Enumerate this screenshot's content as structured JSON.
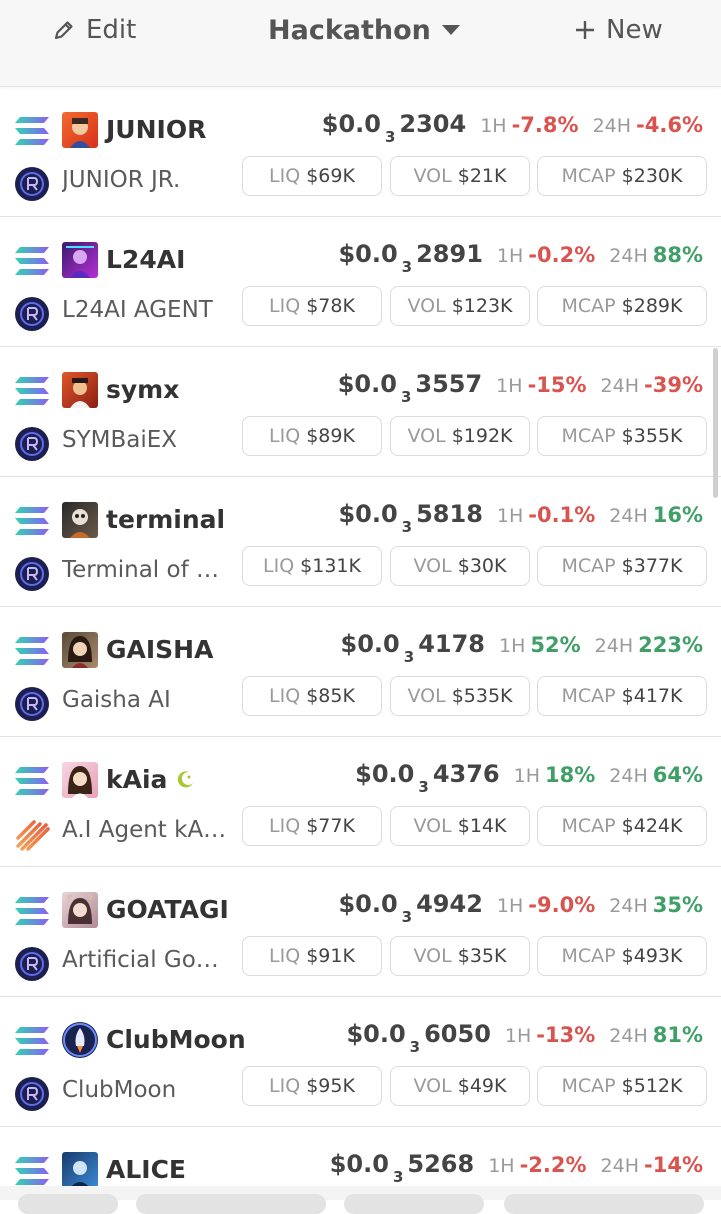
{
  "header": {
    "edit_label": "Edit",
    "title": "Hackathon",
    "new_label": "New"
  },
  "colors": {
    "negative": "#d9534f",
    "positive": "#3f9f67",
    "chain_gradient": [
      "#2fd6b0",
      "#8c5cf6"
    ]
  },
  "price_prefix": "$0.0",
  "labels": {
    "h1": "1H",
    "h24": "24H",
    "liq": "LIQ",
    "vol": "VOL",
    "mcap": "MCAP"
  },
  "tokens": [
    {
      "symbol": "JUNIOR",
      "name": "JUNIOR JR.",
      "zeros": "3",
      "price": "2304",
      "change_1h": "-7.8%",
      "change_24h": "-4.6%",
      "liq": "$69K",
      "vol": "$21K",
      "mcap": "$230K",
      "dex_icon": "raydium-icon"
    },
    {
      "symbol": "L24AI",
      "name": "L24AI AGENT",
      "zeros": "3",
      "price": "2891",
      "change_1h": "-0.2%",
      "change_24h": "88%",
      "liq": "$78K",
      "vol": "$123K",
      "mcap": "$289K",
      "dex_icon": "raydium-icon"
    },
    {
      "symbol": "symx",
      "name": "SYMBaiEX",
      "zeros": "3",
      "price": "3557",
      "change_1h": "-15%",
      "change_24h": "-39%",
      "liq": "$89K",
      "vol": "$192K",
      "mcap": "$355K",
      "dex_icon": "raydium-icon"
    },
    {
      "symbol": "terminal",
      "name": "Terminal of …",
      "zeros": "3",
      "price": "5818",
      "change_1h": "-0.1%",
      "change_24h": "16%",
      "liq": "$131K",
      "vol": "$30K",
      "mcap": "$377K",
      "dex_icon": "raydium-icon"
    },
    {
      "symbol": "GAISHA",
      "name": "Gaisha AI",
      "zeros": "3",
      "price": "4178",
      "change_1h": "52%",
      "change_24h": "223%",
      "liq": "$85K",
      "vol": "$535K",
      "mcap": "$417K",
      "dex_icon": "raydium-icon"
    },
    {
      "symbol": "kAia",
      "name": "A.I Agent kA…",
      "zeros": "3",
      "price": "4376",
      "change_1h": "18%",
      "change_24h": "64%",
      "liq": "$77K",
      "vol": "$14K",
      "mcap": "$424K",
      "dex_icon": "moonshot-icon",
      "badge": "moon-icon"
    },
    {
      "symbol": "GOATAGI",
      "name": "Artificial Go…",
      "zeros": "3",
      "price": "4942",
      "change_1h": "-9.0%",
      "change_24h": "35%",
      "liq": "$91K",
      "vol": "$35K",
      "mcap": "$493K",
      "dex_icon": "raydium-icon"
    },
    {
      "symbol": "ClubMoon",
      "name": "ClubMoon",
      "zeros": "3",
      "price": "6050",
      "change_1h": "-13%",
      "change_24h": "81%",
      "liq": "$95K",
      "vol": "$49K",
      "mcap": "$512K",
      "dex_icon": "raydium-icon"
    },
    {
      "symbol": "ALICE",
      "name": "",
      "zeros": "3",
      "price": "5268",
      "change_1h": "-2.2%",
      "change_24h": "-14%",
      "liq": "",
      "vol": "",
      "mcap": "",
      "dex_icon": "raydium-icon"
    }
  ]
}
